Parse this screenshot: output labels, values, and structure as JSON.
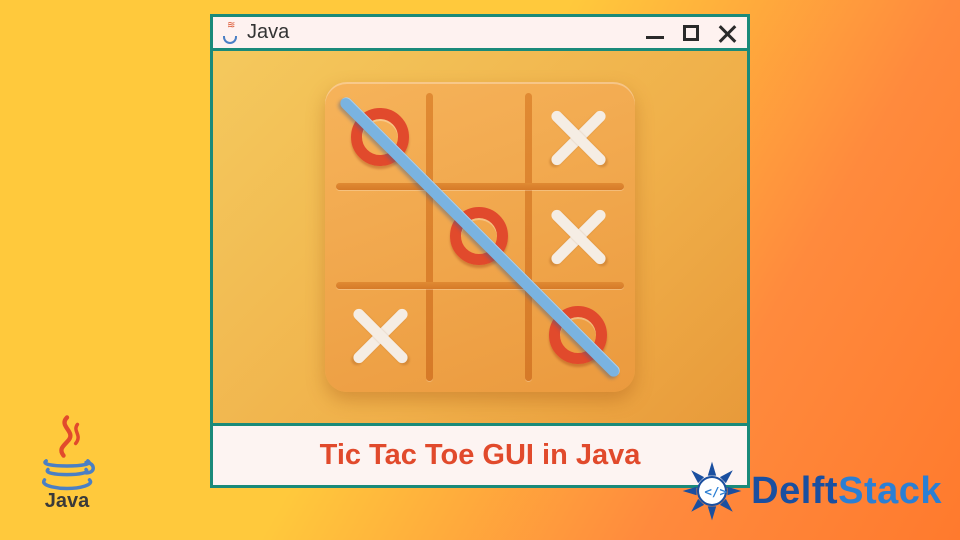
{
  "window": {
    "title": "Java",
    "controls": {
      "min": "minimize",
      "max": "maximize",
      "close": "close"
    }
  },
  "caption": "Tic Tac Toe GUI in Java",
  "board": {
    "cells": [
      "O",
      "",
      "X",
      "",
      "O",
      "X",
      "X",
      "",
      "O"
    ],
    "win_line": "diagonal-tl-br"
  },
  "brand_java": {
    "label": "Java"
  },
  "brand_delft": {
    "part1": "Delft",
    "part2": "Stack"
  }
}
